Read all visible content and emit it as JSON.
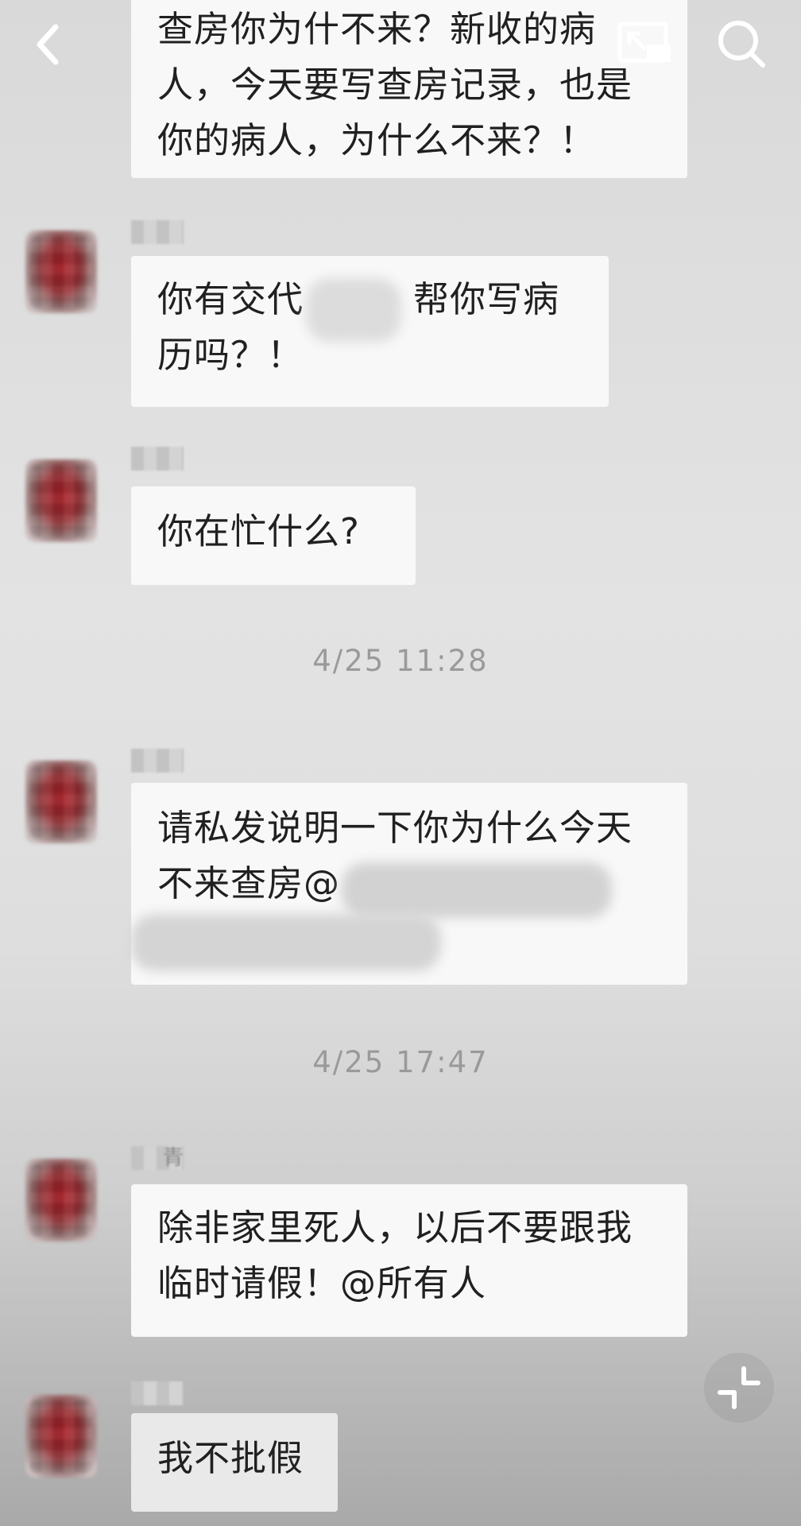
{
  "header": {
    "back_icon": "chevron-left-icon",
    "cast_icon": "screen-cast-icon",
    "search_icon": "search-icon"
  },
  "messages": [
    {
      "text": "查房你为什不来？新收的病人，今天要写查房记录，也是你的病人，为什么不来？！"
    },
    {
      "text": "你有交代　　　帮你写病历吗？！"
    },
    {
      "text": "你在忙什么?"
    },
    {
      "text": "请私发说明一下你为什么今天不来查房@"
    },
    {
      "text": "除非家里死人，以后不要跟我临时请假！@所有人"
    },
    {
      "text": "我不批假"
    }
  ],
  "timestamps": [
    "4/25 11:28",
    "4/25 17:47"
  ],
  "sender_fragments": {
    "msg5": "青"
  },
  "controls": {
    "collapse_icon": "collapse-arrows-icon"
  },
  "colors": {
    "bubble": "#f8f8f8",
    "avatar": "#a5121c",
    "icon": "#ffffff"
  }
}
